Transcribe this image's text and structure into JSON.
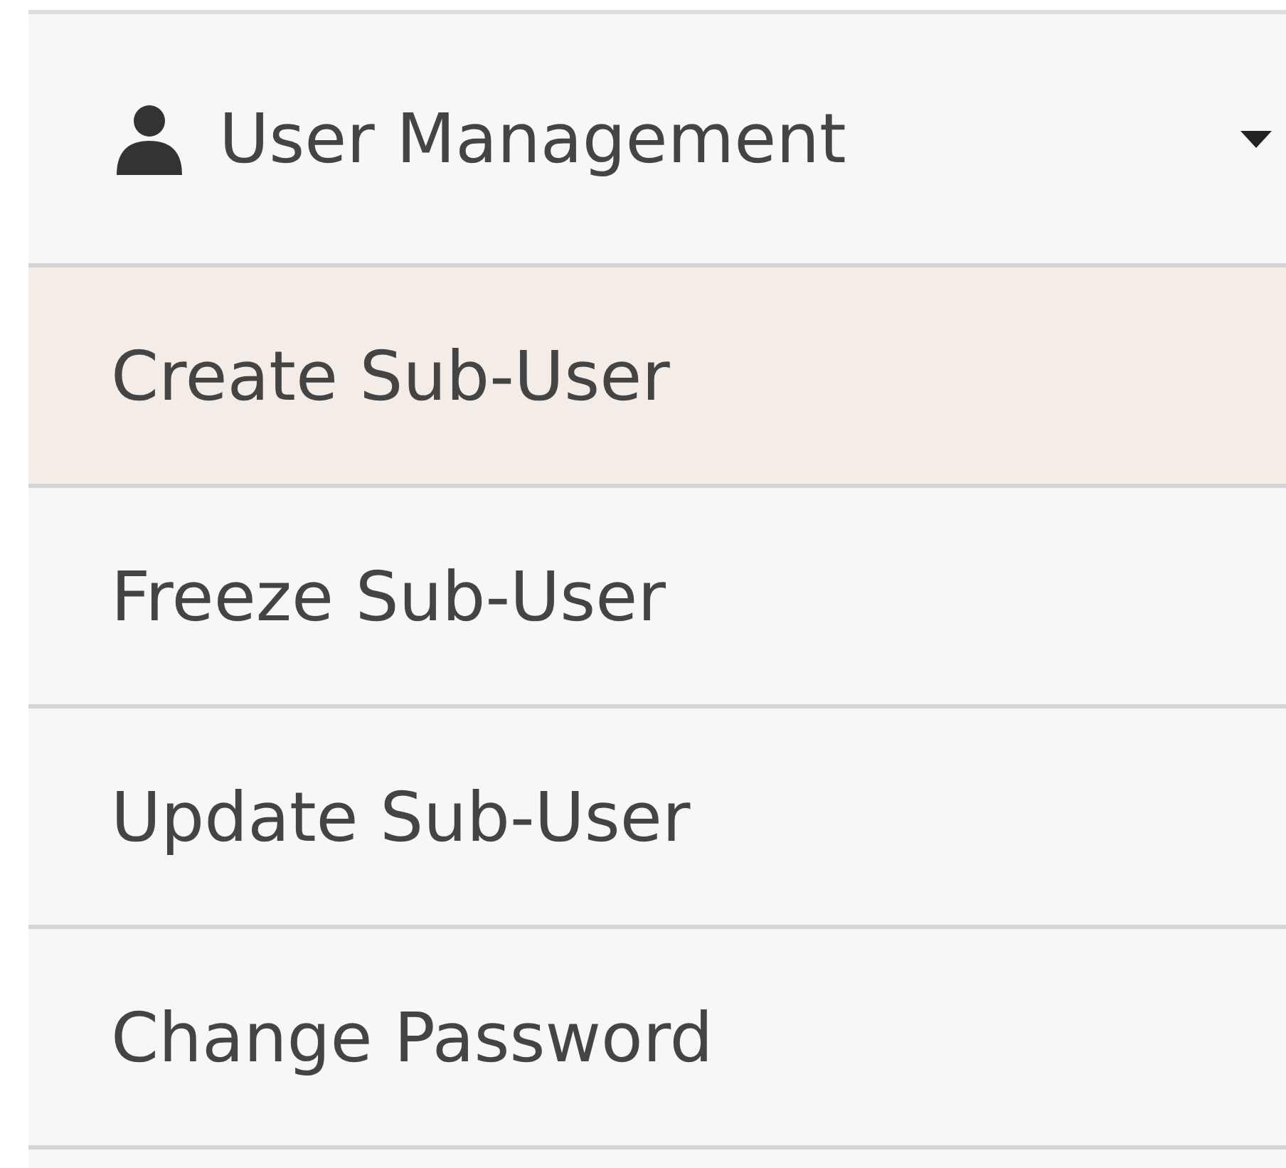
{
  "menu": {
    "title": "User Management",
    "expanded": true,
    "items": [
      {
        "label": "Create Sub-User",
        "selected": true
      },
      {
        "label": "Freeze Sub-User",
        "selected": false
      },
      {
        "label": "Update Sub-User",
        "selected": false
      },
      {
        "label": "Change Password",
        "selected": false
      }
    ]
  }
}
